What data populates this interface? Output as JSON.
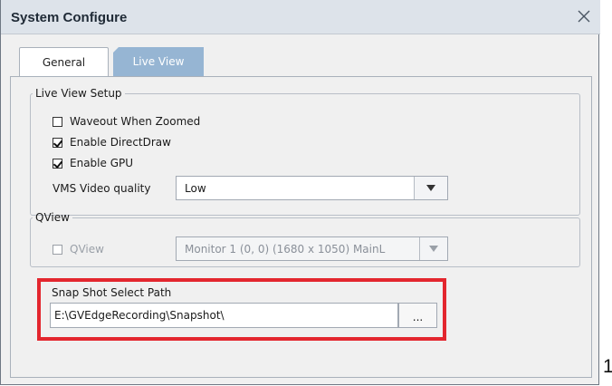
{
  "window": {
    "title": "System Configure",
    "close_glyph": "✕"
  },
  "tabs": [
    {
      "label": "General",
      "active": false
    },
    {
      "label": "Live View",
      "active": true
    }
  ],
  "live_view_setup": {
    "legend": "Live View Setup",
    "options": [
      {
        "label": "Waveout When Zoomed",
        "checked": false
      },
      {
        "label": "Enable DirectDraw",
        "checked": true
      },
      {
        "label": "Enable GPU",
        "checked": true
      }
    ],
    "quality_label": "VMS Video quality",
    "quality_value": "Low"
  },
  "qview": {
    "legend": "QView",
    "checkbox_label": "QView",
    "checked": false,
    "enabled": false,
    "monitor_value": "Monitor 1   (0, 0) (1680 x 1050) MainL"
  },
  "snapshot": {
    "label": "Snap Shot Select Path",
    "path": "E:\\GVEdgeRecording\\Snapshot\\",
    "browse_label": "..."
  },
  "edge_text": "1",
  "colors": {
    "highlight": "#e3262e",
    "active_tab": "#96b5d3",
    "titlebar": "#dde3ea"
  }
}
